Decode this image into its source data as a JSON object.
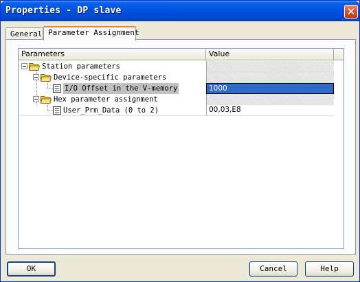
{
  "window": {
    "title": "Properties - DP slave",
    "close_glyph": "✕"
  },
  "tabs": [
    {
      "label": "General",
      "active": false
    },
    {
      "label": "Parameter Assignment",
      "active": true
    }
  ],
  "grid": {
    "headers": {
      "parameters": "Parameters",
      "value": "Value"
    },
    "rows": [
      {
        "name": "Station parameters",
        "value": "",
        "icon": "folder-open-icon"
      },
      {
        "name": "Device-specific parameters",
        "value": "",
        "icon": "folder-open-icon"
      },
      {
        "name": "I/O Offset in the V-memory",
        "value": "1000",
        "icon": "document-icon",
        "selected": true
      },
      {
        "name": "Hex parameter assignment",
        "value": "",
        "icon": "folder-open-icon"
      },
      {
        "name": "User_Prm_Data (0 to 2)",
        "value": "00,03,E8",
        "icon": "document-icon"
      }
    ]
  },
  "buttons": {
    "ok": "OK",
    "cancel": "Cancel",
    "help": "Help"
  },
  "colors": {
    "titlebar": "#0054e3",
    "selection": "#316ac5",
    "tab_accent": "#e68b2c",
    "dialog_bg": "#ece9d8"
  }
}
